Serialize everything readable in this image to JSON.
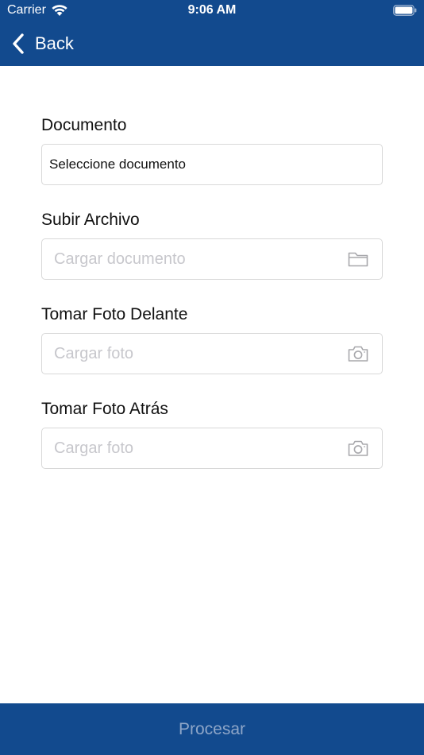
{
  "status_bar": {
    "carrier": "Carrier",
    "time": "9:06 AM",
    "wifi_icon": "wifi-icon",
    "battery_icon": "battery-icon"
  },
  "nav": {
    "back_label": "Back",
    "back_icon": "chevron-left-icon",
    "background_color": "#124a8e"
  },
  "form": {
    "documento": {
      "label": "Documento",
      "value": "Seleccione documento"
    },
    "subir_archivo": {
      "label": "Subir Archivo",
      "placeholder": "Cargar documento",
      "icon": "folder-icon"
    },
    "foto_delante": {
      "label": "Tomar Foto Delante",
      "placeholder": "Cargar foto",
      "icon": "camera-icon"
    },
    "foto_atras": {
      "label": "Tomar Foto Atrás",
      "placeholder": "Cargar foto",
      "icon": "camera-icon"
    }
  },
  "footer": {
    "button_label": "Procesar",
    "background_color": "#124a8e"
  }
}
